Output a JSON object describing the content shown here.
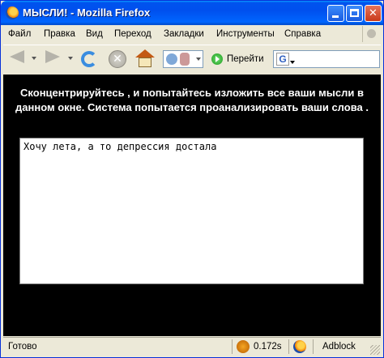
{
  "window": {
    "title": "МЫСЛИ! - Mozilla Firefox"
  },
  "menu": {
    "items": [
      "Файл",
      "Правка",
      "Вид",
      "Переход",
      "Закладки",
      "Инструменты",
      "Справка"
    ]
  },
  "toolbar": {
    "go_label": "Перейти",
    "search_engine_letter": "G",
    "icons": [
      "back-arrow-icon",
      "forward-arrow-icon",
      "reload-icon",
      "stop-icon",
      "home-icon",
      "go-icon"
    ]
  },
  "page": {
    "instructions_line1": "Сконцентрируйтесь , и попытайтесь изложить все ваши мысли в",
    "instructions_line2": "данном окне. Система попытается проанализировать ваши слова .",
    "textarea_value": "Хочу лета, а то депрессия достала"
  },
  "status": {
    "text": "Готово",
    "load_time": "0.172s",
    "adblock_label": "Adblock"
  },
  "colors": {
    "title_bar": "#0053ee",
    "content_background": "#000000",
    "instruction_text": "#ffffff"
  }
}
